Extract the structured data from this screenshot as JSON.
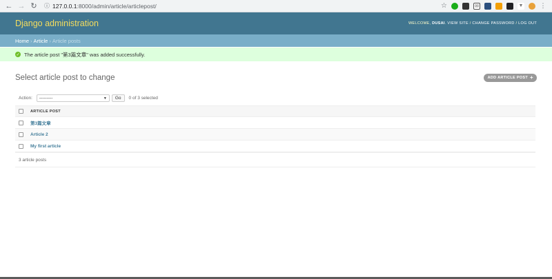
{
  "browser": {
    "url_host": "127.0.0.1",
    "url_path": ":8000/admin/article/articlepost/",
    "icons": [
      "back-icon",
      "forward-icon",
      "reload-icon",
      "info-icon",
      "star-icon",
      "menu-dots-icon"
    ]
  },
  "header": {
    "branding": "Django administration",
    "welcome": "WELCOME,",
    "username": "DUSAI",
    "view_site": "VIEW SITE",
    "change_password": "CHANGE PASSWORD",
    "log_out": "LOG OUT",
    "sep": "/"
  },
  "breadcrumbs": {
    "home": "Home",
    "app": "Article",
    "current": "Article posts",
    "sep": "›"
  },
  "message": {
    "text": "The article post \"第3篇文章\" was added successfully."
  },
  "content": {
    "title": "Select article post to change",
    "add_button": "ADD ARTICLE POST",
    "add_plus": "+"
  },
  "actions": {
    "label": "Action:",
    "selected_value": "---------",
    "go_label": "Go",
    "counter": "0 of 3 selected"
  },
  "table": {
    "column_header": "ARTICLE POST",
    "rows": [
      {
        "title": "第3篇文章"
      },
      {
        "title": "Article 2"
      },
      {
        "title": "My first article"
      }
    ]
  },
  "paginator": {
    "text": "3 article posts"
  },
  "colors": {
    "header_bg": "#417690",
    "branding": "#f5dd5d",
    "breadcrumbs_bg": "#79aec8",
    "success_bg": "#ddffdd",
    "link": "#447e9b"
  }
}
